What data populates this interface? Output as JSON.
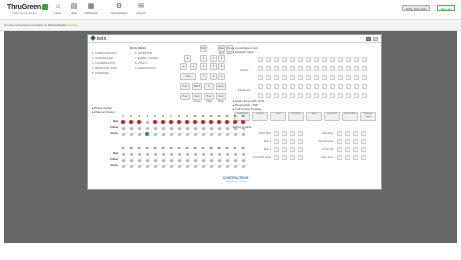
{
  "app": {
    "logo_text": "ThruGreen",
    "logo_tag": "Traffic Signal Solutions"
  },
  "nav": [
    {
      "name": "home",
      "label": "Home",
      "icon": "home-icon",
      "glyph": "⌂"
    },
    {
      "name": "vault",
      "label": "Vault",
      "icon": "vault-icon",
      "glyph": "▤"
    },
    {
      "name": "dashboard",
      "label": "Dashboard",
      "icon": "dashboard-icon",
      "glyph": "▦"
    },
    {
      "name": "administration",
      "label": "Administration",
      "icon": "administration-icon",
      "glyph": "⚙"
    },
    {
      "name": "support",
      "label": "Support",
      "icon": "support-icon",
      "glyph": "✉"
    }
  ],
  "top_right": {
    "user": "EOS_Test_User",
    "action": "Sign out"
  },
  "connection": {
    "text": "You are connected to Controller on Website/Intel1",
    "separator": "|",
    "status": "Connecting..."
  },
  "panel": {
    "product": "EOS",
    "main_menu": {
      "title": "MAIN MENU",
      "items": [
        "1. CONFIGURATION",
        "2. CONTROLLER",
        "3. COORDINATION",
        "4. DETECTOR / PED",
        "5. OVERRIDE",
        "6. DETECTOR",
        "7. EVENT / SCHED",
        "8. UTILITY",
        "9. DIAGNOSTICS"
      ]
    },
    "keypad": {
      "top": [
        "Help",
        "Main Menu",
        "Prev Menu"
      ],
      "row1": [
        "▲",
        "1",
        "2",
        "3"
      ],
      "row2": [
        "◄",
        "►",
        "4",
        "5",
        "6"
      ],
      "row3": [
        "Clear",
        "7",
        "8",
        "9"
      ],
      "row4": [
        "Prev",
        "NEXT",
        "0",
        "Enter"
      ],
      "bottom": [
        "Prev",
        "Next Screen",
        "Prev Page",
        "Next Page"
      ]
    },
    "coordination": {
      "title": "▸ Coordination Unit",
      "detector_title": "▸ Detector Input",
      "vehicle_label": "Vehicle",
      "pedestrian_label": "Pedestrian"
    },
    "hold": {
      "title": "▸ Hold / Force Off / Omit",
      "preemption": "▸ Preemption / TSP",
      "control_title": "▸ Cell Control Overlay",
      "buttons": [
        "Ped Recall",
        "Vehicle",
        "Omit",
        "Ped Omit",
        "Hold",
        "Force Off",
        "Phase Next",
        "Detector Trigger"
      ]
    },
    "ring_control": {
      "title": "▸ Ring Control",
      "rows": [
        {
          "left": "Inhibit Max",
          "right": "Red Rest"
        },
        {
          "left": "Max 2",
          "right": "Ped Recycle"
        },
        {
          "left": "Max 3",
          "right": "Force Off"
        },
        {
          "left": "Omit Red Clear",
          "right": "Stop Time"
        }
      ]
    },
    "phase": {
      "output_title": "▸ Phase Output",
      "channel_title": "▸ Channel Output",
      "header1": [
        "1",
        "2",
        "3",
        "4",
        "5",
        "6",
        "7",
        "8",
        "9",
        "10",
        "11",
        "12",
        "13",
        "14",
        "15",
        "16"
      ],
      "header2": [
        "17",
        "18",
        "19",
        "20",
        "21",
        "22",
        "23",
        "24",
        "25",
        "26",
        "27",
        "28",
        "29",
        "30",
        "31",
        "32"
      ],
      "row_labels": [
        "Red",
        "Yellow",
        "Green"
      ],
      "red_active": [
        true,
        true,
        true,
        false,
        true,
        true,
        true,
        true,
        true,
        true,
        true,
        true,
        true,
        true,
        true,
        true
      ],
      "green_active": [
        false,
        false,
        false,
        true,
        false,
        false,
        false,
        false,
        false,
        false,
        false,
        false,
        false,
        false,
        false,
        false
      ]
    },
    "footer": {
      "brand": "CONTROLTECH",
      "sub": "Intersection Control"
    }
  }
}
